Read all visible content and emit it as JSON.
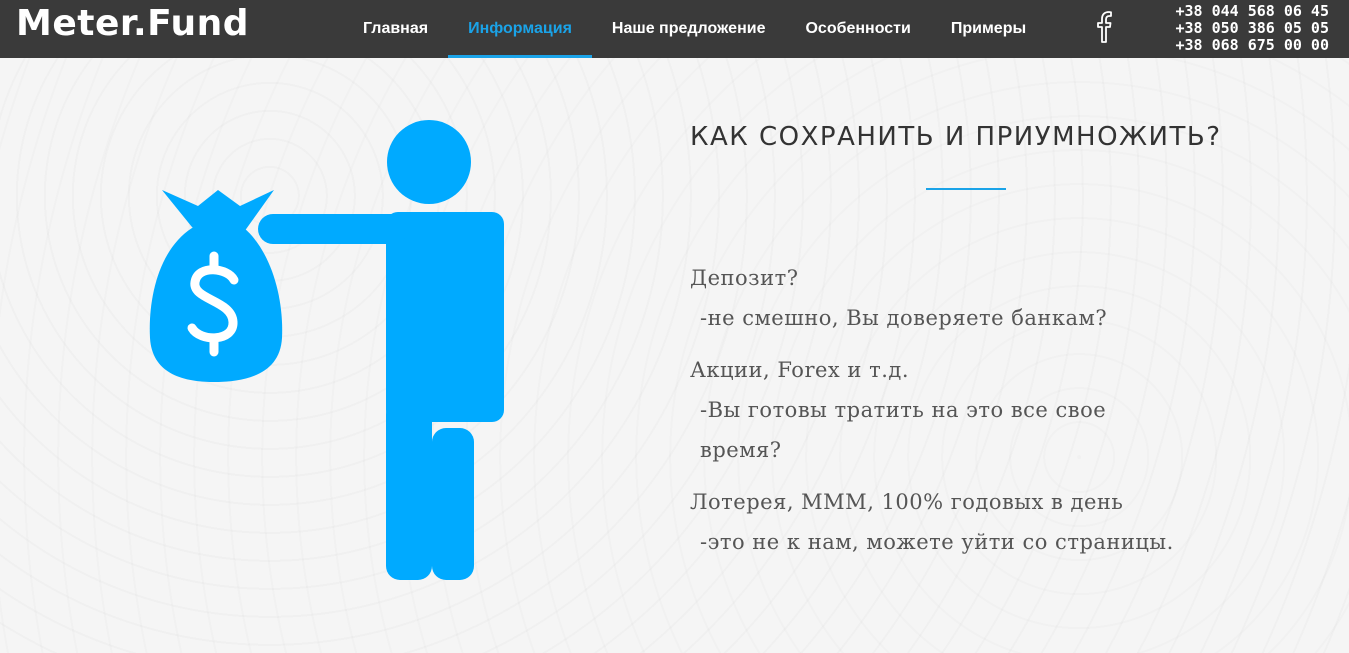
{
  "brand": {
    "logo": "Meter.Fund"
  },
  "nav": {
    "items": [
      {
        "label": "Главная",
        "active": false
      },
      {
        "label": "Информация",
        "active": true
      },
      {
        "label": "Наше предложение",
        "active": false
      },
      {
        "label": "Особенности",
        "active": false
      },
      {
        "label": "Примеры",
        "active": false
      }
    ],
    "social_icon": "facebook-icon"
  },
  "phones": [
    "+38 044 568 06 45",
    "+38 050 386 05 05",
    "+38 068 675 00 00"
  ],
  "main": {
    "heading": "КАК СОХРАНИТЬ И ПРИУМНОЖИТЬ?",
    "paragraphs": [
      {
        "question": "Депозит?",
        "answer": "-не смешно, Вы доверяете банкам?"
      },
      {
        "question": "Акции, Forex и т.д.",
        "answer": "-Вы готовы тратить на это все свое время?"
      },
      {
        "question": "Лотерея, МММ, 100% годовых в день",
        "answer": "-это не к нам, можете уйти со страницы."
      }
    ],
    "illustration": "person-with-money-bag-icon"
  },
  "colors": {
    "accent": "#1aa3e8",
    "header_bg": "#3a3a3a",
    "figure": "#00aaff"
  }
}
